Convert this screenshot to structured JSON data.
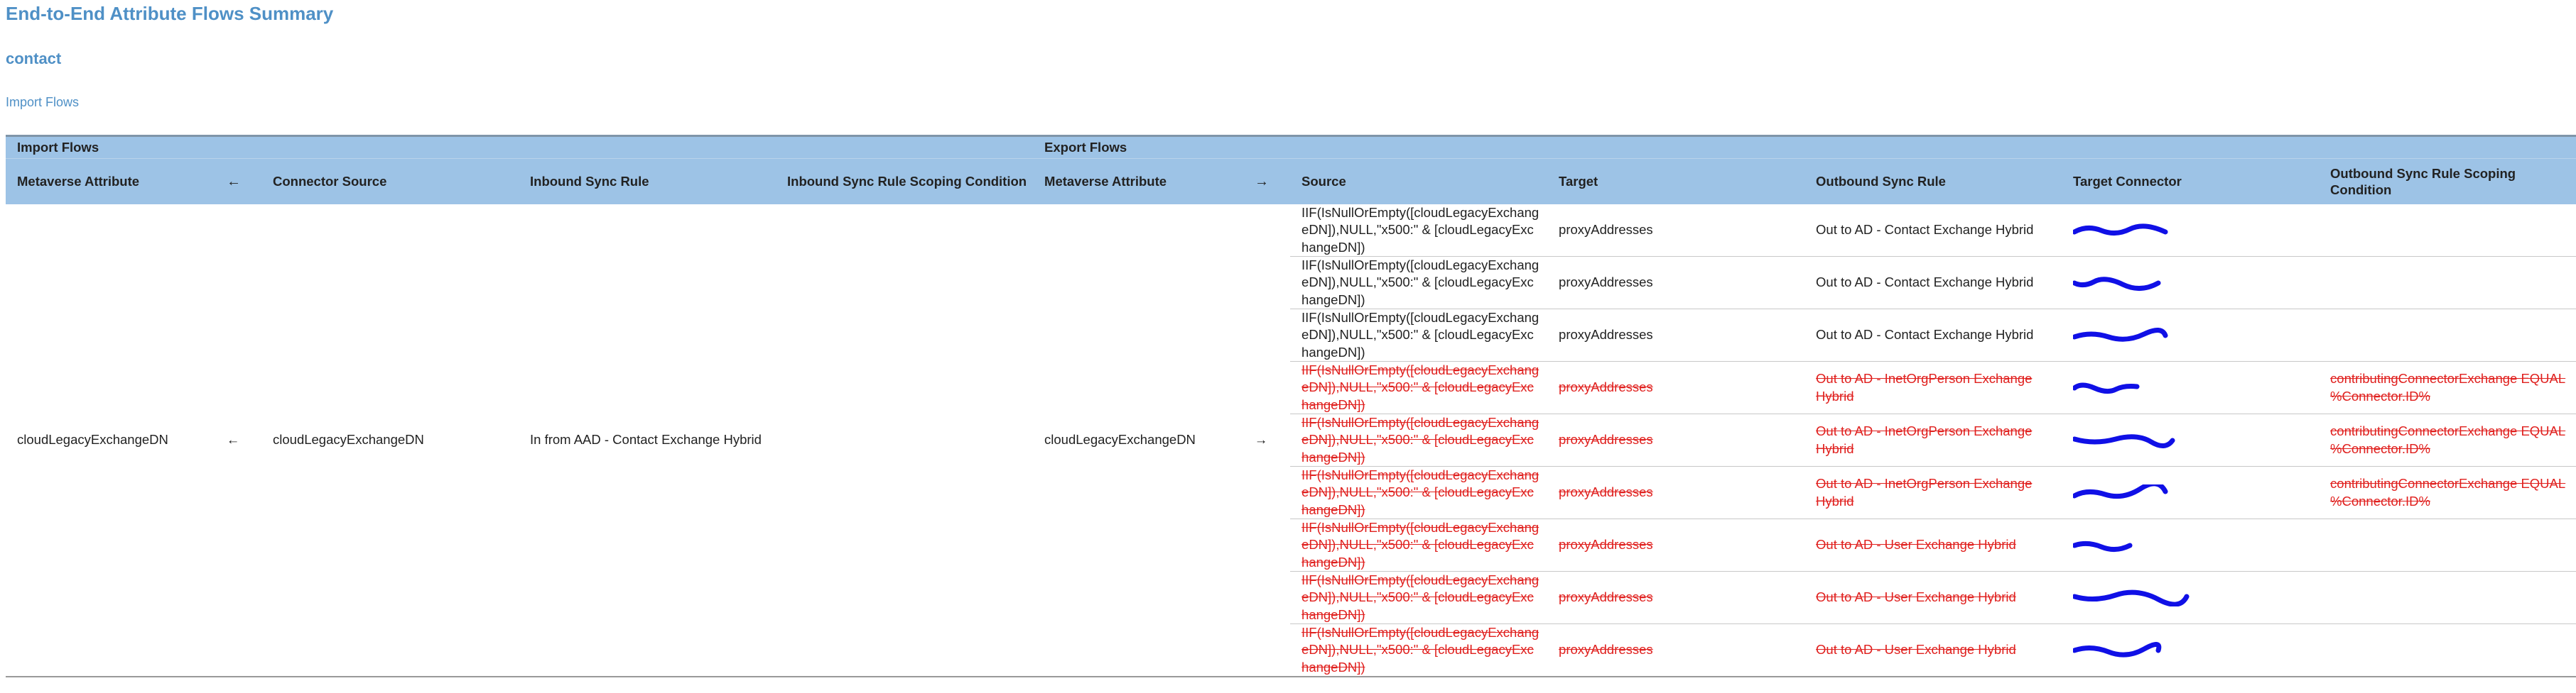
{
  "page": {
    "title": "End-to-End Attribute Flows Summary",
    "object_type": "contact",
    "section": "Import Flows"
  },
  "table": {
    "group_headers": {
      "import": "Import Flows",
      "export": "Export Flows"
    },
    "columns": {
      "import_metaverse_attribute": "Metaverse Attribute",
      "import_arrow": "←",
      "connector_source": "Connector Source",
      "inbound_sync_rule": "Inbound Sync Rule",
      "inbound_scoping": "Inbound Sync Rule Scoping Condition",
      "export_metaverse_attribute": "Metaverse Attribute",
      "export_arrow": "→",
      "source": "Source",
      "target": "Target",
      "outbound_sync_rule": "Outbound Sync Rule",
      "target_connector": "Target Connector",
      "outbound_scoping": "Outbound Sync Rule Scoping Condition"
    },
    "import_row": {
      "metaverse_attribute": "cloudLegacyExchangeDN",
      "arrow": "←",
      "connector_source": "cloudLegacyExchangeDN",
      "inbound_sync_rule": "In from AAD - Contact Exchange Hybrid",
      "scoping": "",
      "export_metaverse_attribute": "cloudLegacyExchangeDN",
      "export_arrow": "→"
    },
    "export_rows": [
      {
        "source": "IIF(IsNullOrEmpty([cloudLegacyExchangeDN]),NULL,\"x500:\" & [cloudLegacyExchangeDN])",
        "target": "proxyAddresses",
        "outbound_sync_rule": "Out to AD - Contact Exchange Hybrid",
        "scoping": "",
        "deleted": false,
        "target_connector": "redacted"
      },
      {
        "source": "IIF(IsNullOrEmpty([cloudLegacyExchangeDN]),NULL,\"x500:\" & [cloudLegacyExchangeDN])",
        "target": "proxyAddresses",
        "outbound_sync_rule": "Out to AD - Contact Exchange Hybrid",
        "scoping": "",
        "deleted": false,
        "target_connector": "redacted"
      },
      {
        "source": "IIF(IsNullOrEmpty([cloudLegacyExchangeDN]),NULL,\"x500:\" & [cloudLegacyExchangeDN])",
        "target": "proxyAddresses",
        "outbound_sync_rule": "Out to AD - Contact Exchange Hybrid",
        "scoping": "",
        "deleted": false,
        "target_connector": "redacted"
      },
      {
        "source": "IIF(IsNullOrEmpty([cloudLegacyExchangeDN]),NULL,\"x500:\" & [cloudLegacyExchangeDN])",
        "target": "proxyAddresses",
        "outbound_sync_rule": "Out to AD - InetOrgPerson Exchange Hybrid",
        "scoping": "contributingConnectorExchange EQUAL %Connector.ID%",
        "deleted": true,
        "target_connector": "redacted"
      },
      {
        "source": "IIF(IsNullOrEmpty([cloudLegacyExchangeDN]),NULL,\"x500:\" & [cloudLegacyExchangeDN])",
        "target": "proxyAddresses",
        "outbound_sync_rule": "Out to AD - InetOrgPerson Exchange Hybrid",
        "scoping": "contributingConnectorExchange EQUAL %Connector.ID%",
        "deleted": true,
        "target_connector": "redacted"
      },
      {
        "source": "IIF(IsNullOrEmpty([cloudLegacyExchangeDN]),NULL,\"x500:\" & [cloudLegacyExchangeDN])",
        "target": "proxyAddresses",
        "outbound_sync_rule": "Out to AD - InetOrgPerson Exchange Hybrid",
        "scoping": "contributingConnectorExchange EQUAL %Connector.ID%",
        "deleted": true,
        "target_connector": "redacted"
      },
      {
        "source": "IIF(IsNullOrEmpty([cloudLegacyExchangeDN]),NULL,\"x500:\" & [cloudLegacyExchangeDN])",
        "target": "proxyAddresses",
        "outbound_sync_rule": "Out to AD - User Exchange Hybrid",
        "scoping": "",
        "deleted": true,
        "target_connector": "redacted"
      },
      {
        "source": "IIF(IsNullOrEmpty([cloudLegacyExchangeDN]),NULL,\"x500:\" & [cloudLegacyExchangeDN])",
        "target": "proxyAddresses",
        "outbound_sync_rule": "Out to AD - User Exchange Hybrid",
        "scoping": "",
        "deleted": true,
        "target_connector": "redacted"
      },
      {
        "source": "IIF(IsNullOrEmpty([cloudLegacyExchangeDN]),NULL,\"x500:\" & [cloudLegacyExchangeDN])",
        "target": "proxyAddresses",
        "outbound_sync_rule": "Out to AD - User Exchange Hybrid",
        "scoping": "",
        "deleted": true,
        "target_connector": "redacted"
      }
    ]
  },
  "colors": {
    "heading_blue": "#4f90c6",
    "header_fill": "#9dc3e6",
    "deleted_red": "#e0201e",
    "redaction_blue": "#1010e6"
  }
}
